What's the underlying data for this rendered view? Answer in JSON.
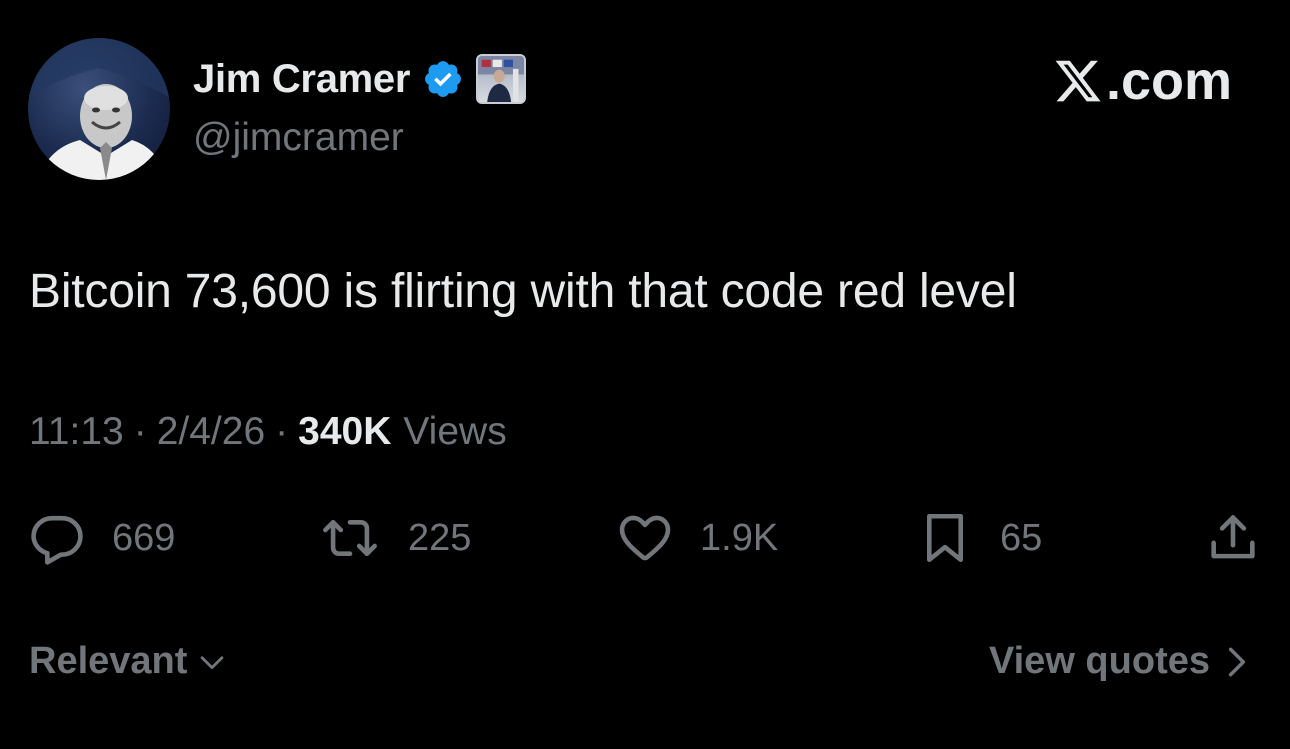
{
  "author": {
    "display_name": "Jim Cramer",
    "handle": "@jimcramer",
    "verified": true,
    "avatar_icon": "profile-photo",
    "affiliate_badge_icon": "affiliate-badge-photo"
  },
  "brand": {
    "logo_icon": "x-logo",
    "suffix": ".com"
  },
  "tweet": {
    "text": "Bitcoin 73,600 is flirting with that code red level",
    "time": "11:13",
    "date": "2/4/26",
    "separator": "·",
    "views_count": "340K",
    "views_label": "Views"
  },
  "actions": {
    "reply": {
      "icon": "reply-icon",
      "count": "669"
    },
    "retweet": {
      "icon": "retweet-icon",
      "count": "225"
    },
    "like": {
      "icon": "heart-icon",
      "count": "1.9K"
    },
    "bookmark": {
      "icon": "bookmark-icon",
      "count": "65"
    },
    "share": {
      "icon": "share-icon"
    }
  },
  "footer": {
    "sort_label": "Relevant",
    "view_quotes_label": "View quotes"
  },
  "colors": {
    "background": "#000000",
    "primary_text": "#e7e9ea",
    "secondary_text": "#71767b",
    "verified_blue": "#1d9bf0"
  }
}
